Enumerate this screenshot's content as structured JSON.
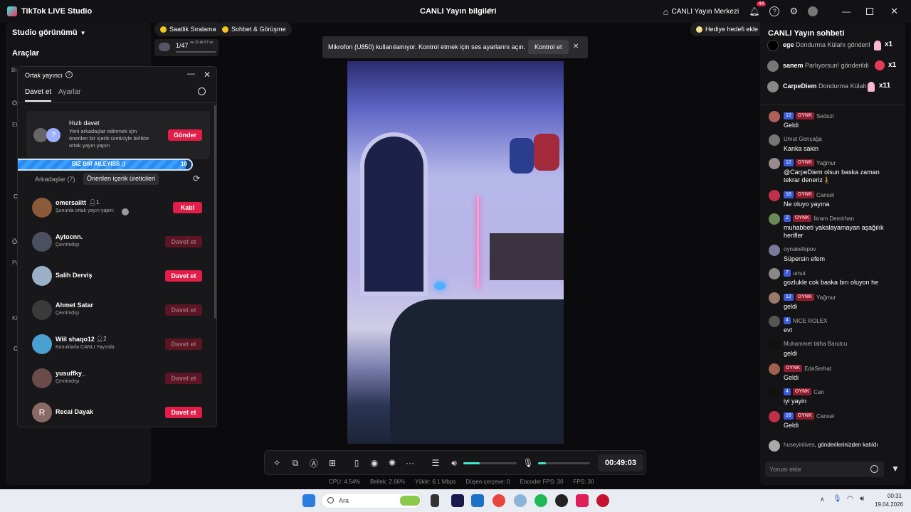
{
  "app": {
    "title": "TikTok LIVE Studio",
    "center_title": "CANLI Yayın bilgileri",
    "live_center": "CANLI Yayın Merkezi",
    "notif_count": "44"
  },
  "left": {
    "studio_view": "Studio görünümü",
    "tools": "Araçlar",
    "stray_letters": [
      "Bi",
      "O",
      "Et",
      "C",
      "Ö",
      "Pa",
      "Ki",
      "C",
      "l"
    ]
  },
  "topchips": {
    "ranking": "Saatlik Sıralama",
    "chat_call": "Sohbet & Görüşme",
    "goal": "Hediye hedefi ekle",
    "mini_progress": "1/47",
    "mini_timer": "se 10 dk 57 sn"
  },
  "banner": {
    "text": "Mikrofon (U850) kullanılamıyor. Kontrol etmek için ses ayarlarını açın.",
    "button": "Kontrol et"
  },
  "dialog": {
    "title": "Ortak yayıncı",
    "tabs": [
      "Davet et",
      "Ayarlar"
    ],
    "quick": {
      "title": "Hızlı davet",
      "desc": "Yeni arkadaşlar edinmek için önerilen bir içerik üreticiyle birlikte ortak yayın yapın",
      "button": "Gönder"
    },
    "team_bar": {
      "left": "12",
      "label": "BIZ BIR AILEYISS :)",
      "right": "10",
      "progress": 0.97
    },
    "list_tabs": [
      "Arkadaşlar (7)",
      "Önerilen içerik üreticileri"
    ],
    "creators": [
      {
        "name": "omersaiitt",
        "count": "1",
        "sub": "Şununla ortak yayın yapın:",
        "btn": "Katıl",
        "enabled": true
      },
      {
        "name": "Aytocnn.",
        "count": "",
        "sub": "Çevrimdışı",
        "btn": "Davet et",
        "enabled": false
      },
      {
        "name": "Salih Derviş",
        "count": "",
        "sub": "",
        "btn": "Davet et",
        "enabled": true
      },
      {
        "name": "Ahmet Satar",
        "count": "",
        "sub": "Çevrimdışı",
        "btn": "Davet et",
        "enabled": false
      },
      {
        "name": "Wiil shaqo12",
        "count": "2",
        "sub": "Konuklarla CANLI Yayında",
        "btn": "Davet et",
        "enabled": false
      },
      {
        "name": "yusuffky_",
        "count": "",
        "sub": "Çevrimdışı",
        "btn": "Davet et",
        "enabled": false
      },
      {
        "name": "Recai Dayak",
        "count": "",
        "sub": "",
        "btn": "Davet et",
        "enabled": true
      }
    ],
    "recai_initial": "R"
  },
  "chat": {
    "title": "CANLI Yayın sohbeti",
    "gifts": [
      {
        "user": "ege",
        "text": "Dondurma Külahı gönderil",
        "mult": "x1"
      },
      {
        "user": "sanem",
        "text": "Parlıyorsun! gönderildi",
        "mult": "x1"
      },
      {
        "user": "CarpeDiem",
        "text": "Dondurma Külah",
        "mult": "x11"
      }
    ],
    "messages": [
      {
        "lvl": "12",
        "fan": "OYNK",
        "name": "Seduzi",
        "text": "Geldi"
      },
      {
        "lvl": "",
        "fan": "",
        "name": "Umut Gençağa",
        "text": "Kanka sakin"
      },
      {
        "lvl": "12",
        "fan": "OYNK",
        "name": "Yağmur",
        "text": "@CarpeDiem olsun baska zaman tekrar deneriz🧎"
      },
      {
        "lvl": "16",
        "fan": "OYNK",
        "name": "Cansel",
        "text": "Ne oluyo yayına"
      },
      {
        "lvl": "2",
        "fan": "OYNK",
        "name": "İkram Demirhan",
        "text": "muhabbeti yakalayamayan aşağılık herifler"
      },
      {
        "lvl": "",
        "fan": "",
        "name": "oynakefepov",
        "text": "Süpersin efem"
      },
      {
        "lvl": "7",
        "fan": "",
        "name": "umut",
        "text": "gozlukle cok baska bırı oluyon he"
      },
      {
        "lvl": "12",
        "fan": "OYNK",
        "name": "Yağmur",
        "text": "geldi"
      },
      {
        "lvl": "4",
        "fan": "",
        "name": "NİCE ROLEX",
        "text": "evt"
      },
      {
        "lvl": "",
        "fan": "",
        "name": "Muhammet talha Barutcu",
        "text": "geldi"
      },
      {
        "lvl": "",
        "fan": "OYNK",
        "name": "EdaSerhat",
        "text": "Geldi"
      },
      {
        "lvl": "4",
        "fan": "OYNK",
        "name": "Can",
        "text": "iyi yayin"
      },
      {
        "lvl": "16",
        "fan": "OYNK",
        "name": "Cansel",
        "text": "Geldi"
      }
    ],
    "joined": {
      "user": "huseyinlives",
      "text": ", gönderilerinizden katıldı"
    },
    "input_placeholder": "Yorum ekle"
  },
  "controls": {
    "timer": "00:49:03",
    "volume": 0.3,
    "mic": 0.15
  },
  "stats": {
    "cpu": "CPU:  4.54%",
    "mem": "Bellek:  2.66%",
    "upload": "Yükle:  6.1 Mbps",
    "dropped": "Düşen çerçeve:  0",
    "encoder": "Encoder FPS:  30",
    "fps": "FPS:  30"
  },
  "taskbar": {
    "search": "Ara",
    "time": "00:31",
    "date": "19.04.2026"
  }
}
